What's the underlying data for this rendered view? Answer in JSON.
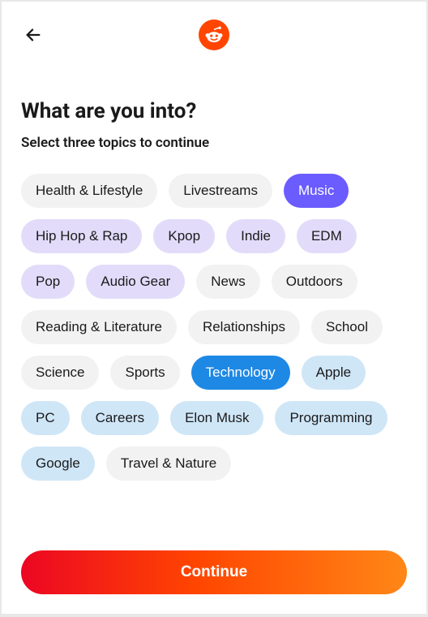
{
  "title": "What are you into?",
  "subtitle": "Select three topics to continue",
  "continue_label": "Continue",
  "topics": [
    {
      "label": "Health & Lifestyle",
      "style": "default"
    },
    {
      "label": "Livestreams",
      "style": "default"
    },
    {
      "label": "Music",
      "style": "selected-purple"
    },
    {
      "label": "Hip Hop & Rap",
      "style": "sub-purple"
    },
    {
      "label": "Kpop",
      "style": "sub-purple"
    },
    {
      "label": "Indie",
      "style": "sub-purple"
    },
    {
      "label": "EDM",
      "style": "sub-purple"
    },
    {
      "label": "Pop",
      "style": "sub-purple"
    },
    {
      "label": "Audio Gear",
      "style": "sub-purple"
    },
    {
      "label": "News",
      "style": "default"
    },
    {
      "label": "Outdoors",
      "style": "default"
    },
    {
      "label": "Reading & Literature",
      "style": "default"
    },
    {
      "label": "Relationships",
      "style": "default"
    },
    {
      "label": "School",
      "style": "default"
    },
    {
      "label": "Science",
      "style": "default"
    },
    {
      "label": "Sports",
      "style": "default"
    },
    {
      "label": "Technology",
      "style": "selected-blue"
    },
    {
      "label": "Apple",
      "style": "sub-blue"
    },
    {
      "label": "PC",
      "style": "sub-blue"
    },
    {
      "label": "Careers",
      "style": "sub-blue"
    },
    {
      "label": "Elon Musk",
      "style": "sub-blue"
    },
    {
      "label": "Programming",
      "style": "sub-blue"
    },
    {
      "label": "Google",
      "style": "sub-blue"
    },
    {
      "label": "Travel & Nature",
      "style": "default"
    }
  ]
}
